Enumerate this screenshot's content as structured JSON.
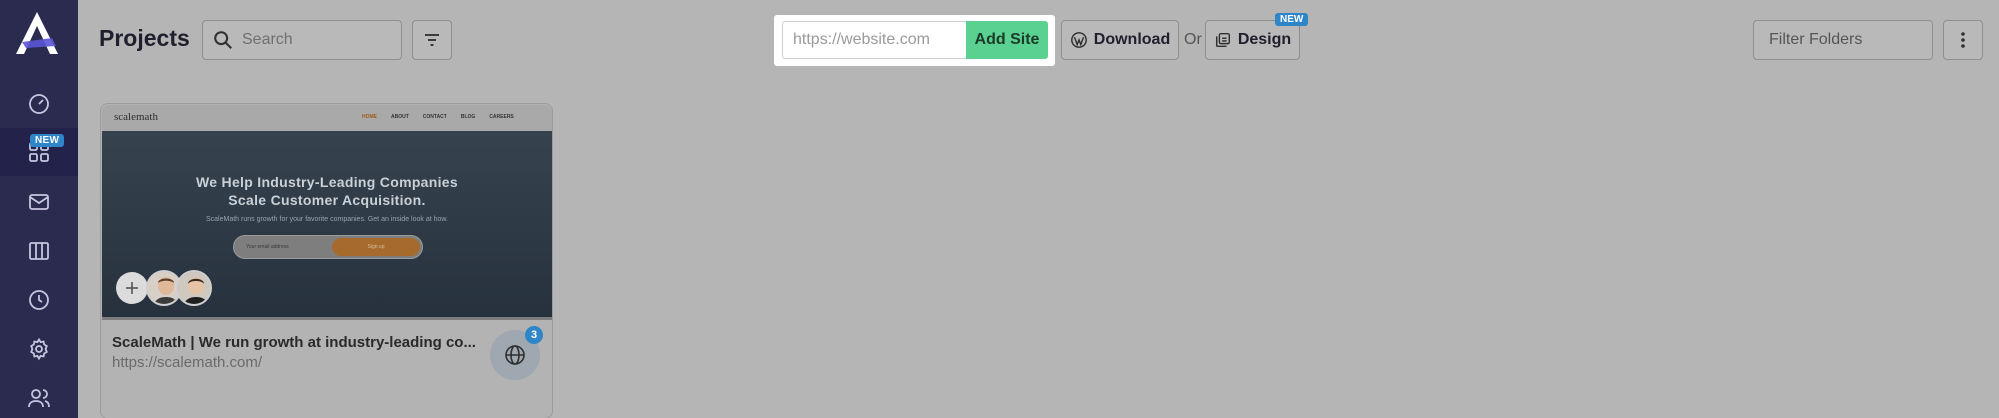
{
  "colors": {
    "sidebar_bg": "#2b2a4f",
    "accent_green": "#5bd191",
    "badge_blue": "#2e86c8",
    "page_bg": "#b5b5b5"
  },
  "sidebar": {
    "items": [
      {
        "name": "dashboard",
        "icon": "speedometer-icon"
      },
      {
        "name": "projects",
        "icon": "grid-icon",
        "badge": "NEW",
        "active": true
      },
      {
        "name": "inbox",
        "icon": "mail-icon"
      },
      {
        "name": "boards",
        "icon": "columns-icon"
      },
      {
        "name": "history",
        "icon": "clock-icon"
      },
      {
        "name": "settings",
        "icon": "gear-icon"
      },
      {
        "name": "team",
        "icon": "users-icon"
      }
    ]
  },
  "header": {
    "title": "Projects",
    "search_placeholder": "Search",
    "url_placeholder": "https://website.com",
    "add_site_label": "Add Site",
    "download_label": "Download",
    "or_text": "Or",
    "design_label": "Design",
    "design_badge": "NEW",
    "filter_folders_label": "Filter Folders"
  },
  "projects": [
    {
      "title": "ScaleMath | We run growth at industry-leading co...",
      "url": "https://scalemath.com/",
      "comment_count": "3",
      "thumbnail": {
        "logo": "scalemath",
        "nav_links": [
          "HOME",
          "ABOUT",
          "CONTACT",
          "BLOG",
          "CAREERS"
        ],
        "hero_title_line1": "We Help Industry-Leading Companies",
        "hero_title_line2": "Scale Customer Acquisition.",
        "hero_subtitle": "ScaleMath runs growth for your favorite companies. Get an inside look at how.",
        "form_placeholder": "Your email address",
        "form_button": "Sign up"
      }
    }
  ]
}
